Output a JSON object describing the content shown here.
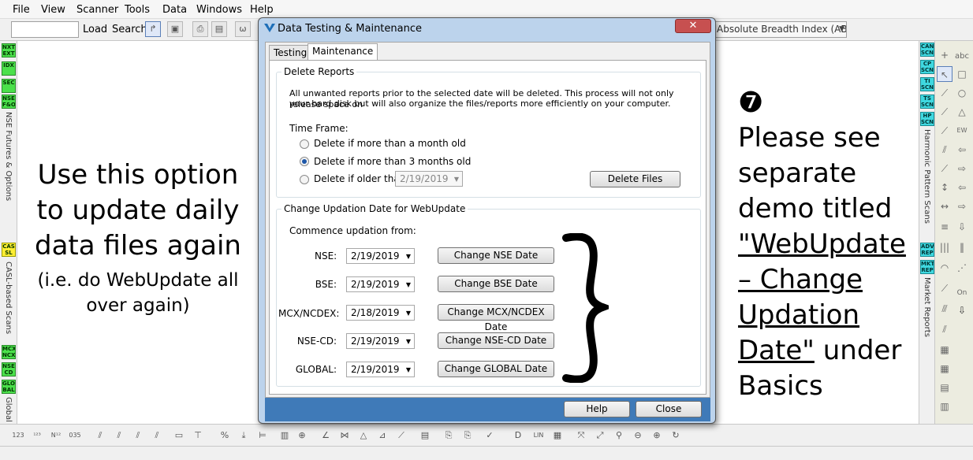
{
  "menu": [
    "File",
    "View",
    "Scanner",
    "Tools",
    "Data",
    "Windows",
    "Help"
  ],
  "toolbar": {
    "search_value": "",
    "load_label": "Load",
    "search_label": "Search",
    "indicator_value": "Absolute Breadth Index (ABI"
  },
  "left_buttons": [
    "NXT EXT",
    "IDX",
    "SEC",
    "NSE F&O",
    "CAS SL",
    "MCX NCX",
    "NSE CD",
    "GLO BAL"
  ],
  "left_labels": {
    "futures": "NSE Futures & Options",
    "casl": "CASL-based Scans",
    "global": "Global I"
  },
  "right_buttons": [
    "CAN SCN",
    "CP SCN",
    "TI SCN",
    "TS SCN",
    "HP SCN",
    "ADV REP",
    "MKT REP"
  ],
  "right_labels": {
    "harmonic": "Harmonic Pattern Scans",
    "market": "Market Reports"
  },
  "annotation_left": {
    "main": "Use this option to update daily data files again",
    "sub": "(i.e. do WebUpdate all over again)"
  },
  "annotation_right": {
    "number": "❼",
    "line1": "Please see separate demo titled",
    "link": "\"WebUpdate – Change Updation Date\"",
    "line2": "under Basics"
  },
  "dialog": {
    "title": "Data Testing & Maintenance",
    "close": "✕",
    "tabs": [
      "Testing",
      "Maintenance"
    ],
    "delete_reports": {
      "legend": "Delete Reports",
      "desc1": "All unwanted reports prior to the selected date will be deleted. This process will not only release space on",
      "desc2": "your hard disk but will also organize the files/reports more efficiently on your computer.",
      "time_frame": "Time Frame:",
      "opt1": "Delete if more than a month old",
      "opt2": "Delete if more than 3 months old",
      "opt3": "Delete if older than",
      "date": "2/19/2019",
      "delete_btn": "Delete Files"
    },
    "change_date": {
      "legend": "Change Updation Date for WebUpdate",
      "commence": "Commence updation from:",
      "rows": [
        {
          "label": "NSE:",
          "date": "2/19/2019",
          "btn": "Change NSE Date"
        },
        {
          "label": "BSE:",
          "date": "2/19/2019",
          "btn": "Change BSE Date"
        },
        {
          "label": "MCX/NCDEX:",
          "date": "2/18/2019",
          "btn": "Change MCX/NCDEX Date"
        },
        {
          "label": "NSE-CD:",
          "date": "2/19/2019",
          "btn": "Change NSE-CD Date"
        },
        {
          "label": "GLOBAL:",
          "date": "2/19/2019",
          "btn": "Change GLOBAL Date"
        }
      ]
    },
    "help_btn": "Help",
    "close_btn": "Close"
  }
}
